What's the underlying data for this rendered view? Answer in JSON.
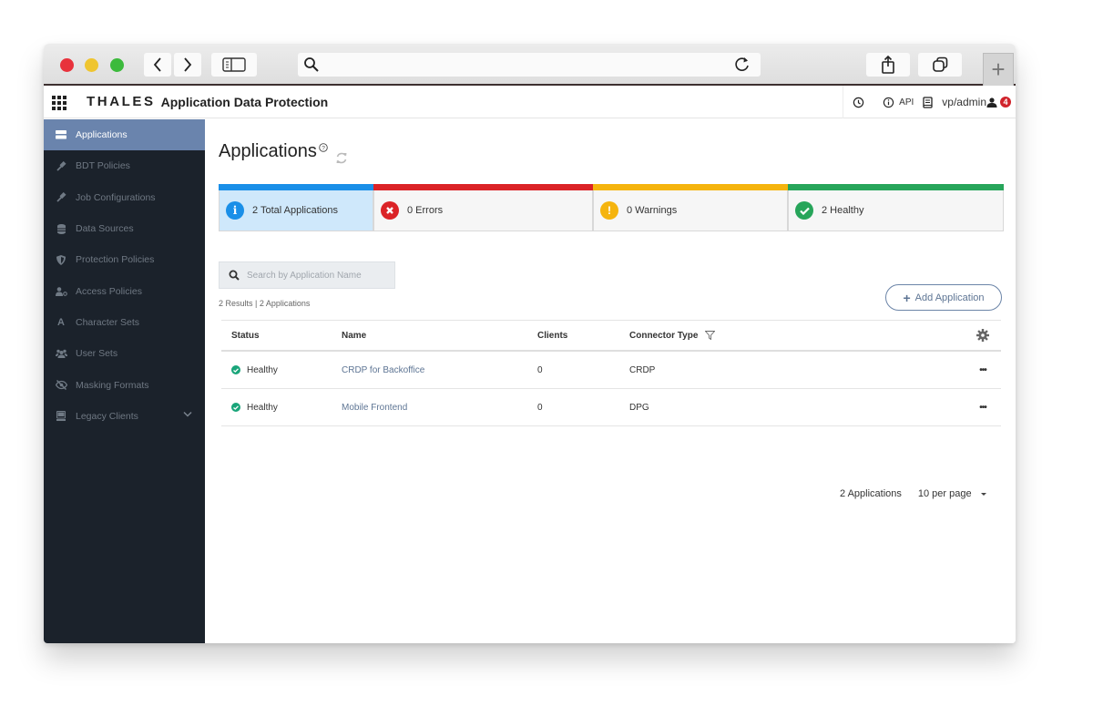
{
  "browser": {
    "url": "",
    "buttons": [
      "back",
      "forward",
      "sidebar",
      "share",
      "tabs",
      "new-tab"
    ]
  },
  "header": {
    "brand": "THALES",
    "title": "Application Data Protection",
    "api_label": "API",
    "user": "vp/admin",
    "notification_count": "4"
  },
  "sidebar": {
    "items": [
      {
        "label": "Applications",
        "icon": "server-icon",
        "active": true
      },
      {
        "label": "BDT Policies",
        "icon": "gavel-icon"
      },
      {
        "label": "Job Configurations",
        "icon": "gavel-icon"
      },
      {
        "label": "Data Sources",
        "icon": "database-icon"
      },
      {
        "label": "Protection Policies",
        "icon": "shield-icon"
      },
      {
        "label": "Access Policies",
        "icon": "user-key-icon"
      },
      {
        "label": "Character Sets",
        "icon": "font-icon"
      },
      {
        "label": "User Sets",
        "icon": "users-icon"
      },
      {
        "label": "Masking Formats",
        "icon": "eye-slash-icon"
      },
      {
        "label": "Legacy Clients",
        "icon": "monitor-icon",
        "expandable": true
      }
    ]
  },
  "main": {
    "title": "Applications",
    "help_mark": "?",
    "summary": [
      {
        "label": "2 Total Applications",
        "color": "#1a8fe8",
        "icon": "info-icon"
      },
      {
        "label": "0 Errors",
        "color": "#db2327",
        "icon": "error-icon"
      },
      {
        "label": "0 Warnings",
        "color": "#f5b40e",
        "icon": "warning-icon"
      },
      {
        "label": "2 Healthy",
        "color": "#27a55a",
        "icon": "check-icon"
      }
    ],
    "search_placeholder": "Search by Application Name",
    "results_text": "2 Results | 2 Applications",
    "add_button": "Add Application",
    "table": {
      "columns": [
        "Status",
        "Name",
        "Clients",
        "Connector Type"
      ],
      "rows": [
        {
          "status": "Healthy",
          "name": "CRDP for Backoffice",
          "clients": "0",
          "connector": "CRDP"
        },
        {
          "status": "Healthy",
          "name": "Mobile Frontend",
          "clients": "0",
          "connector": "DPG"
        }
      ]
    },
    "pager": {
      "total": "2 Applications",
      "per_page": "10 per page"
    }
  }
}
